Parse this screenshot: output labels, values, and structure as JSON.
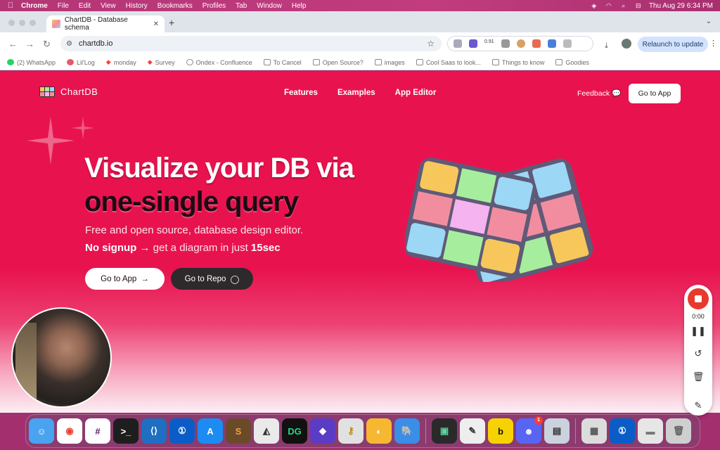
{
  "menubar": {
    "app_name": "Chrome",
    "items": [
      "File",
      "Edit",
      "View",
      "History",
      "Bookmarks",
      "Profiles",
      "Tab",
      "Window",
      "Help"
    ],
    "clock": "Thu Aug 29  6:34 PM"
  },
  "browser": {
    "tab_title": "ChartDB - Database schema",
    "url": "chartdb.io",
    "ext_count": "0.91",
    "relaunch_label": "Relaunch to update",
    "bookmarks": [
      "(2) WhatsApp",
      "Lil'Log",
      "monday",
      "Survey",
      "Ondex - Confluence",
      "To Cancel",
      "Open Source?",
      "images",
      "Cool Saas to look...",
      "Things to know",
      "Goodies"
    ]
  },
  "page": {
    "brand": "ChartDB",
    "nav": [
      "Features",
      "Examples",
      "App Editor"
    ],
    "feedback_label": "Feedback",
    "top_cta": "Go to App",
    "headline_line1": "Visualize your DB via",
    "headline_line2": "one-single query",
    "subtitle": "Free and open source, database design editor.",
    "sub2_bold1": "No signup",
    "sub2_mid": " → get a diagram in just ",
    "sub2_bold2": "15sec",
    "cta_primary": "Go to App",
    "cta_secondary": "Go to Repo",
    "colors": {
      "accent": "#e8134e",
      "dark": "#2e2a2c"
    }
  },
  "recorder": {
    "time": "0:00"
  },
  "dock": {
    "discord_badge": "1"
  }
}
